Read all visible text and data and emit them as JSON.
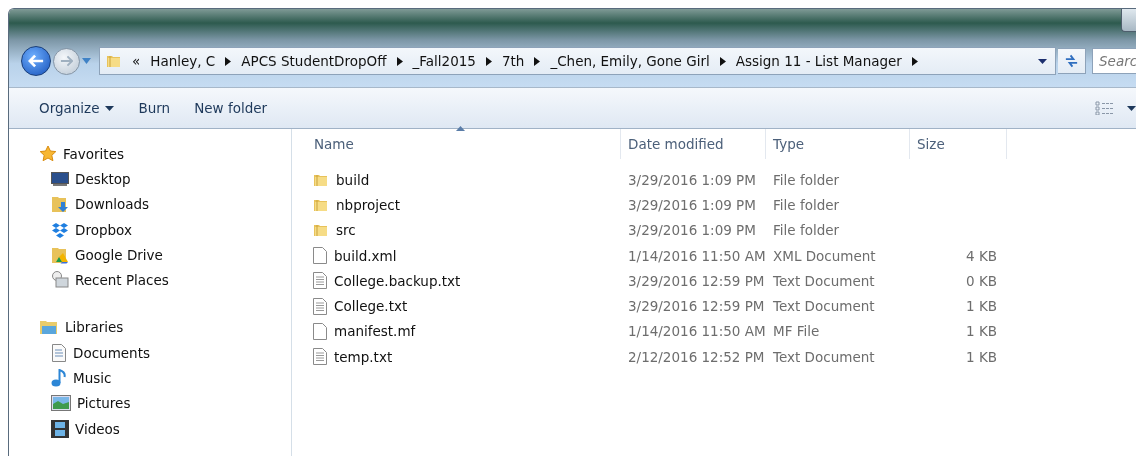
{
  "address_bar": {
    "overflow": "«",
    "path": [
      "Hanley, C",
      "APCS StudentDropOff",
      "_Fall2015",
      "7th",
      "_Chen, Emily, Gone Girl",
      "Assign 11 - List Manager"
    ]
  },
  "search": {
    "placeholder": "Searc"
  },
  "toolbar": {
    "buttons": [
      {
        "label": "Organize",
        "kind": "menu"
      },
      {
        "label": "Burn",
        "kind": "plain"
      },
      {
        "label": "New folder",
        "kind": "plain"
      }
    ]
  },
  "sidebar": {
    "groups": [
      {
        "label": "Favorites",
        "kind": "favorites",
        "items": [
          {
            "label": "Desktop",
            "kind": "desktop"
          },
          {
            "label": "Downloads",
            "kind": "downloads"
          },
          {
            "label": "Dropbox",
            "kind": "dropbox"
          },
          {
            "label": "Google Drive",
            "kind": "drive"
          },
          {
            "label": "Recent Places",
            "kind": "recent"
          }
        ]
      },
      {
        "label": "Libraries",
        "kind": "libraries",
        "items": [
          {
            "label": "Documents",
            "kind": "documents"
          },
          {
            "label": "Music",
            "kind": "music"
          },
          {
            "label": "Pictures",
            "kind": "pictures"
          },
          {
            "label": "Videos",
            "kind": "videos"
          }
        ]
      }
    ]
  },
  "table": {
    "columns": [
      {
        "label": "Name",
        "sorted": true
      },
      {
        "label": "Date modified",
        "sorted": false
      },
      {
        "label": "Type",
        "sorted": false
      },
      {
        "label": "Size",
        "sorted": false
      }
    ],
    "rows": [
      {
        "kind": "folder",
        "name": "build",
        "date": "3/29/2016 1:09 PM",
        "type": "File folder"
      },
      {
        "kind": "folder",
        "name": "nbproject",
        "date": "3/29/2016 1:09 PM",
        "type": "File folder"
      },
      {
        "kind": "folder",
        "name": "src",
        "date": "3/29/2016 1:09 PM",
        "type": "File folder"
      },
      {
        "kind": "file",
        "name": "build.xml",
        "date": "1/14/2016 11:50 AM",
        "type": "XML Document",
        "size": "4 KB"
      },
      {
        "kind": "text",
        "name": "College.backup.txt",
        "date": "3/29/2016 12:59 PM",
        "type": "Text Document",
        "size": "0 KB"
      },
      {
        "kind": "text",
        "name": "College.txt",
        "date": "3/29/2016 12:59 PM",
        "type": "Text Document",
        "size": "1 KB"
      },
      {
        "kind": "file",
        "name": "manifest.mf",
        "date": "1/14/2016 11:50 AM",
        "type": "MF File",
        "size": "1 KB"
      },
      {
        "kind": "text",
        "name": "temp.txt",
        "date": "2/12/2016 12:52 PM",
        "type": "Text Document",
        "size": "1 KB"
      }
    ]
  }
}
